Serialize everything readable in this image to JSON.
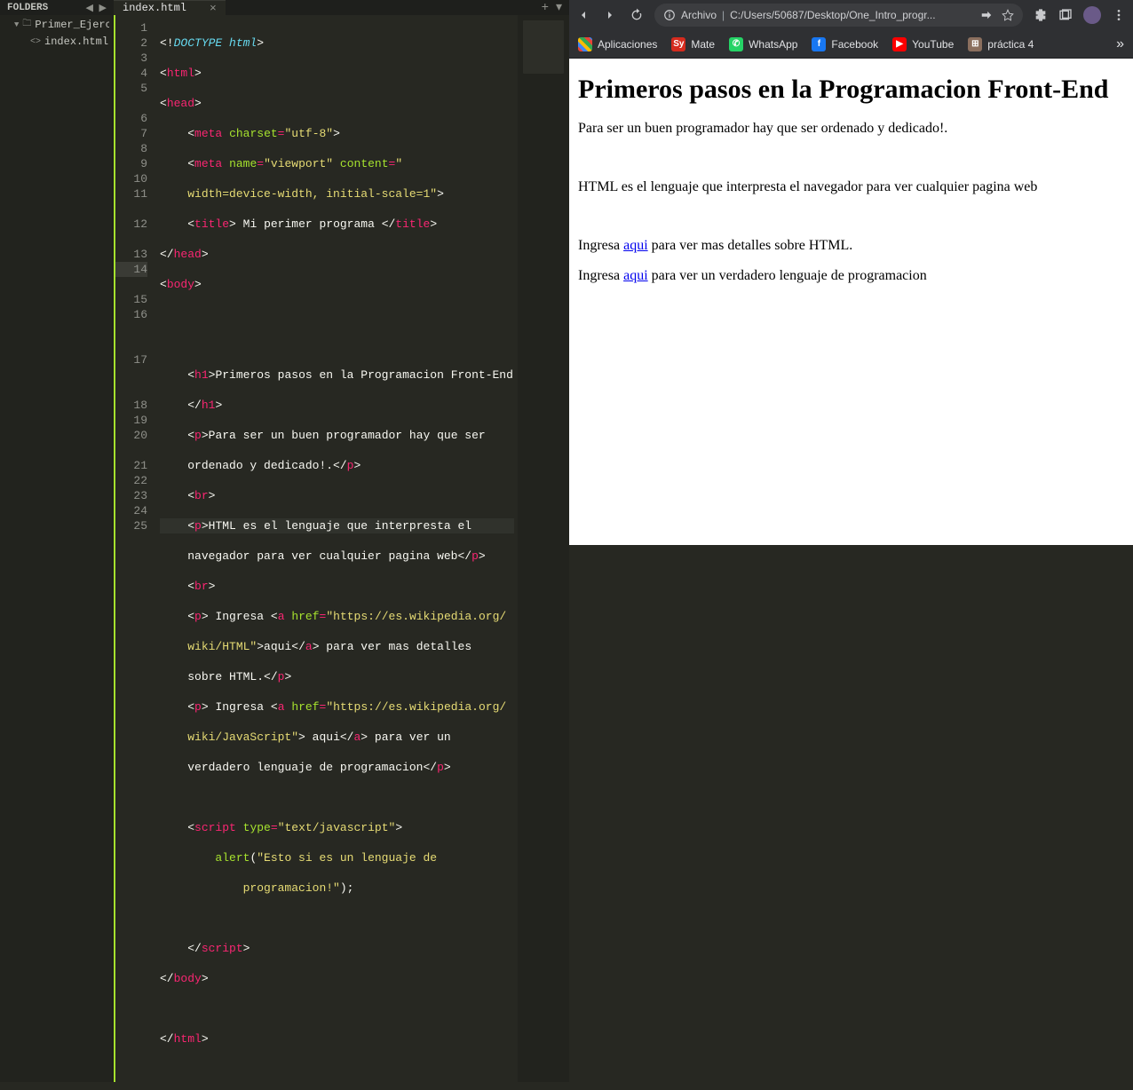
{
  "sidebar": {
    "header": "FOLDERS",
    "project": "Primer_Ejercicio",
    "file": "index.html"
  },
  "tabs": {
    "active": "index.html"
  },
  "gutter_lines": [
    "1",
    "2",
    "3",
    "4",
    "5",
    "6",
    "7",
    "8",
    "9",
    "10",
    "11",
    "12",
    "13",
    "14",
    "15",
    "16",
    "17",
    "18",
    "19",
    "20",
    "21",
    "22",
    "23",
    "24",
    "25"
  ],
  "code": {
    "l1_a": "<!",
    "l1_b": "DOCTYPE",
    "l1_c": " html",
    "l1_d": ">",
    "l2_a": "<",
    "l2_b": "html",
    "l2_c": ">",
    "l3_a": "<",
    "l3_b": "head",
    "l3_c": ">",
    "l4_a": "    <",
    "l4_b": "meta",
    "l4_c": " ",
    "l4_d": "charset",
    "l4_e": "=",
    "l4_f": "\"utf-8\"",
    "l4_g": ">",
    "l5_a": "    <",
    "l5_b": "meta",
    "l5_c": " ",
    "l5_d": "name",
    "l5_e": "=",
    "l5_f": "\"viewport\"",
    "l5_g": " ",
    "l5_h": "content",
    "l5_i": "=",
    "l5_j": "\"",
    "l5w": "    width=device-width, initial-scale=1\"",
    "l5w2": ">",
    "l6_a": "    <",
    "l6_b": "title",
    "l6_c": ">",
    "l6_d": " Mi perimer programa ",
    "l6_e": "</",
    "l6_f": "title",
    "l6_g": ">",
    "l7_a": "</",
    "l7_b": "head",
    "l7_c": ">",
    "l8_a": "<",
    "l8_b": "body",
    "l8_c": ">",
    "l11_a": "    <",
    "l11_b": "h1",
    "l11_c": ">",
    "l11_d": "Primeros pasos en la Programacion Front-End",
    "l11w_a": "    </",
    "l11w_b": "h1",
    "l11w_c": ">",
    "l12_a": "    <",
    "l12_b": "p",
    "l12_c": ">",
    "l12_d": "Para ser un buen programador hay que ser ",
    "l12w": "    ordenado y dedicado!.",
    "l12w_a": "</",
    "l12w_b": "p",
    "l12w_c": ">",
    "l13_a": "    <",
    "l13_b": "br",
    "l13_c": ">",
    "l14_a": "    <",
    "l14_b": "p",
    "l14_c": ">",
    "l14_d": "HTML es el lenguaje que interpresta el ",
    "l14w": "    navegador para ver cualquier pagina web",
    "l14w_a": "</",
    "l14w_b": "p",
    "l14w_c": ">",
    "l15_a": "    <",
    "l15_b": "br",
    "l15_c": ">",
    "l16_a": "    <",
    "l16_b": "p",
    "l16_c": ">",
    "l16_d": " Ingresa ",
    "l16_e": "<",
    "l16_f": "a",
    "l16_g": " ",
    "l16_h": "href",
    "l16_i": "=",
    "l16_j": "\"https://es.wikipedia.org/",
    "l16w": "    wiki/HTML\"",
    "l16w_a": ">",
    "l16w_b": "aqui",
    "l16w_c": "</",
    "l16w_d": "a",
    "l16w_e": ">",
    "l16w_f": " para ver mas detalles ",
    "l16w2": "    sobre HTML.",
    "l16w2_a": "</",
    "l16w2_b": "p",
    "l16w2_c": ">",
    "l17_a": "    <",
    "l17_b": "p",
    "l17_c": ">",
    "l17_d": " Ingresa ",
    "l17_e": "<",
    "l17_f": "a",
    "l17_g": " ",
    "l17_h": "href",
    "l17_i": "=",
    "l17_j": "\"https://es.wikipedia.org/",
    "l17w": "    wiki/JavaScript\"",
    "l17w_a": ">",
    "l17w_b": " aqui",
    "l17w_c": "</",
    "l17w_d": "a",
    "l17w_e": ">",
    "l17w_f": " para ver un ",
    "l17w2": "    verdadero lenguaje de programacion",
    "l17w2_a": "</",
    "l17w2_b": "p",
    "l17w2_c": ">",
    "l19_a": "    <",
    "l19_b": "script",
    "l19_c": " ",
    "l19_d": "type",
    "l19_e": "=",
    "l19_f": "\"text/javascript\"",
    "l19_g": ">",
    "l20_a": "        ",
    "l20_b": "alert",
    "l20_c": "(",
    "l20_d": "\"Esto si es un lenguaje de ",
    "l20w": "            programacion!\"",
    "l20w_a": ");",
    "l22_a": "    </",
    "l22_b": "script",
    "l22_c": ">",
    "l23_a": "</",
    "l23_b": "body",
    "l23_c": ">",
    "l25_a": "</",
    "l25_b": "html",
    "l25_c": ">"
  },
  "browser": {
    "url_source": "Archivo",
    "url_text": "C:/Users/50687/Desktop/One_Intro_progr...",
    "bookmarks": {
      "apps": "Aplicaciones",
      "mate": "Mate",
      "whatsapp": "WhatsApp",
      "facebook": "Facebook",
      "youtube": "YouTube",
      "practica": "práctica 4"
    },
    "page": {
      "h1": "Primeros pasos en la Programacion Front-End",
      "p1": "Para ser un buen programador hay que ser ordenado y dedicado!.",
      "p2": "HTML es el lenguaje que interpresta el navegador para ver cualquier pagina web",
      "p3_a": "Ingresa ",
      "p3_link": "aqui",
      "p3_b": " para ver mas detalles sobre HTML.",
      "p4_a": "Ingresa ",
      "p4_link": "aqui",
      "p4_b": " para ver un verdadero lenguaje de programacion"
    }
  }
}
